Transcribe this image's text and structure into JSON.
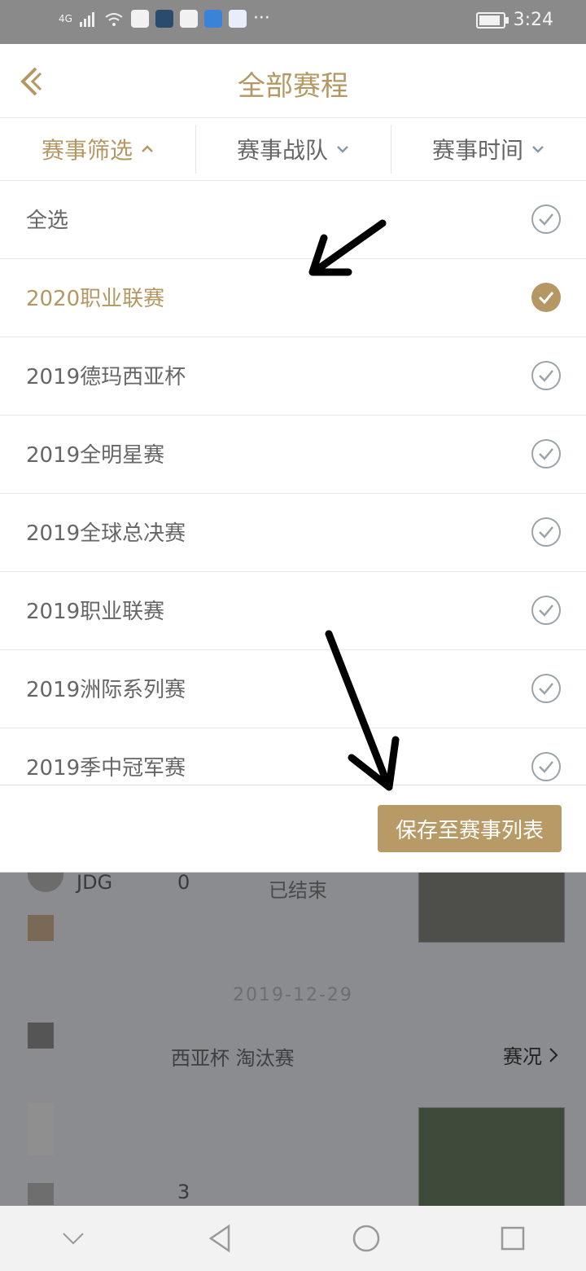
{
  "status_bar": {
    "network": "4G",
    "time": "3:24",
    "more": "···"
  },
  "header": {
    "title": "全部赛程"
  },
  "tabs": [
    {
      "label": "赛事筛选",
      "active": true
    },
    {
      "label": "赛事战队",
      "active": false
    },
    {
      "label": "赛事时间",
      "active": false
    }
  ],
  "list": [
    {
      "label": "全选",
      "selected": false
    },
    {
      "label": "2020职业联赛",
      "selected": true
    },
    {
      "label": "2019德玛西亚杯",
      "selected": false
    },
    {
      "label": "2019全明星赛",
      "selected": false
    },
    {
      "label": "2019全球总决赛",
      "selected": false
    },
    {
      "label": "2019职业联赛",
      "selected": false
    },
    {
      "label": "2019洲际系列赛",
      "selected": false
    },
    {
      "label": "2019季中冠军赛",
      "selected": false
    }
  ],
  "save_button": {
    "label": "保存至赛事列表"
  },
  "background": {
    "team": "JDG",
    "score": "0",
    "status": "已结束",
    "date": "2019-12-29",
    "match_name": "西亚杯 淘汰赛",
    "situation": "赛况",
    "score2": "3"
  },
  "colors": {
    "accent": "#b59763",
    "button": "#b89a66"
  }
}
